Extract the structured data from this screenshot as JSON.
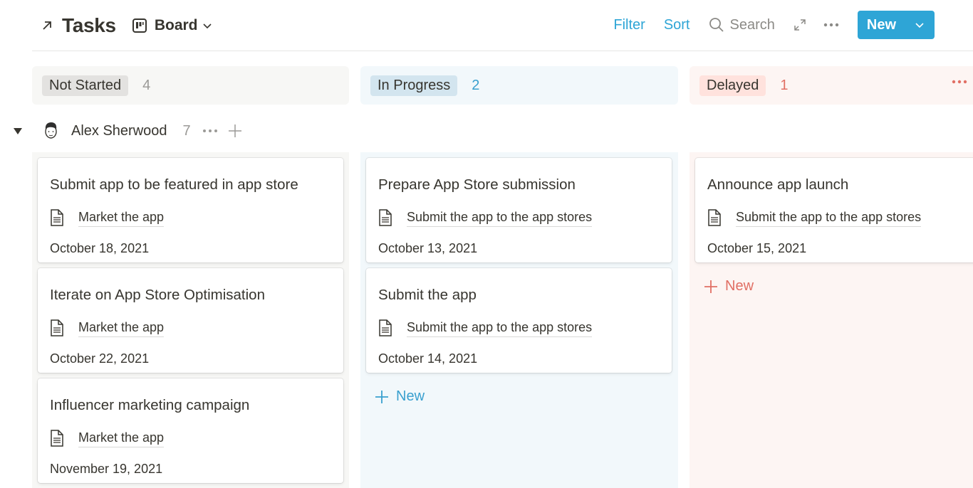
{
  "header": {
    "title": "Tasks",
    "view_label": "Board",
    "filter_label": "Filter",
    "sort_label": "Sort",
    "search_label": "Search",
    "new_label": "New",
    "accent_color": "#2ea5d6"
  },
  "group": {
    "name": "Alex Sherwood",
    "count": "7"
  },
  "columns": [
    {
      "status": "Not Started",
      "count": "4",
      "cards": [
        {
          "title": "Submit app to be featured in app store",
          "relation": "Market the app",
          "date": "October 18, 2021"
        },
        {
          "title": "Iterate on App Store Optimisation",
          "relation": "Market the app",
          "date": "October 22, 2021"
        },
        {
          "title": "Influencer marketing campaign",
          "relation": "Market the app",
          "date": "November 19, 2021"
        }
      ]
    },
    {
      "status": "In Progress",
      "count": "2",
      "add_label": "New",
      "cards": [
        {
          "title": "Prepare App Store submission",
          "relation": "Submit the app to the app stores",
          "date": "October 13, 2021"
        },
        {
          "title": "Submit the app",
          "relation": "Submit the app to the app stores",
          "date": "October 14, 2021"
        }
      ]
    },
    {
      "status": "Delayed",
      "count": "1",
      "add_label": "New",
      "cards": [
        {
          "title": "Announce app launch",
          "relation": "Submit the app to the app stores",
          "date": "October 15, 2021"
        }
      ]
    }
  ]
}
